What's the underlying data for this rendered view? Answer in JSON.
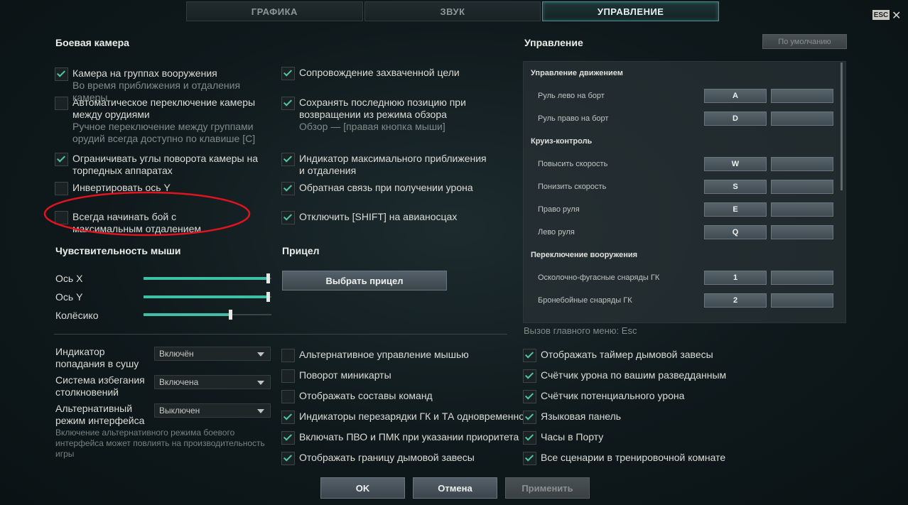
{
  "tabs": [
    {
      "label": "ГРАФИКА",
      "active": false
    },
    {
      "label": "ЗВУК",
      "active": false
    },
    {
      "label": "УПРАВЛЕНИЕ",
      "active": true
    }
  ],
  "esc_label": "ESC",
  "close_glyph": "✕",
  "combat_camera": {
    "title": "Боевая камера",
    "left": [
      {
        "label": "Камера на группах вооружения",
        "sub": "Во время приближения и отдаления камеры",
        "checked": true
      },
      {
        "label": "Автоматическое переключение камеры между орудиями",
        "sub": "Ручное переключение между группами орудий всегда доступно по клавише [C]",
        "checked": false
      },
      {
        "label": "Ограничивать углы поворота камеры на торпедных аппаратах",
        "sub": "",
        "checked": true
      },
      {
        "label": "Инвертировать ось Y",
        "sub": "",
        "checked": false
      },
      {
        "label": "Всегда начинать бой с максимальным отдалением",
        "sub": "",
        "checked": false
      }
    ],
    "right": [
      {
        "label": "Сопровождение захваченной цели",
        "sub": "",
        "checked": true
      },
      {
        "label": "Сохранять последнюю позицию при возвращении из режима обзора",
        "sub": "Обзор — [правая кнопка мыши]",
        "checked": true
      },
      {
        "label": "Индикатор максимального приближения и отдаления",
        "sub": "",
        "checked": true
      },
      {
        "label": "Обратная связь при получении урона",
        "sub": "",
        "checked": true
      },
      {
        "label": "Отключить [SHIFT] на авианосцах",
        "sub": "",
        "checked": true
      }
    ]
  },
  "mouse": {
    "title": "Чувствительность мыши",
    "sliders": [
      {
        "label": "Ось X",
        "value": 0.97
      },
      {
        "label": "Ось Y",
        "value": 0.97
      },
      {
        "label": "Колёсико",
        "value": 0.68
      }
    ]
  },
  "sight": {
    "title": "Прицел",
    "button": "Выбрать прицел"
  },
  "controls": {
    "title": "Управление",
    "default_button": "По умолчанию",
    "groups": [
      {
        "title": "Управление движением",
        "actions": [
          {
            "label": "Руль лево на борт",
            "key": "A"
          },
          {
            "label": "Руль право на борт",
            "key": "D"
          }
        ]
      },
      {
        "title": "Круиз-контроль",
        "actions": [
          {
            "label": "Повысить скорость",
            "key": "W"
          },
          {
            "label": "Понизить скорость",
            "key": "S"
          },
          {
            "label": "Право руля",
            "key": "E"
          },
          {
            "label": "Лево руля",
            "key": "Q"
          }
        ]
      },
      {
        "title": "Переключение вооружения",
        "actions": [
          {
            "label": "Осколочно-фугасные снаряды ГК",
            "key": "1"
          },
          {
            "label": "Бронебойные снаряды ГК",
            "key": "2"
          }
        ]
      }
    ],
    "menu_hint": "Вызов главного меню: Esc"
  },
  "dropdowns": [
    {
      "label": "Индикатор попадания в сушу",
      "value": "Включён"
    },
    {
      "label": "Система избегания столкновений",
      "value": "Включена"
    },
    {
      "label": "Альтернативный режим интерфейса",
      "value": "Выключен"
    }
  ],
  "interface_note": "Включение альтернативного режима боевого интерфейса может повлиять на производительность игры",
  "bottom_mid": [
    {
      "label": "Альтернативное управление мышью",
      "checked": false
    },
    {
      "label": "Поворот миникарты",
      "checked": false
    },
    {
      "label": "Отображать составы команд",
      "checked": false
    },
    {
      "label": "Индикаторы перезарядки ГК и ТА одновременно",
      "checked": true
    },
    {
      "label": "Включать ПВО и ПМК при указании приоритета",
      "checked": true
    },
    {
      "label": "Отображать границу дымовой завесы",
      "checked": true
    }
  ],
  "bottom_right": [
    {
      "label": "Отображать таймер дымовой завесы",
      "checked": true
    },
    {
      "label": "Счётчик урона по вашим разведданным",
      "checked": true
    },
    {
      "label": "Счётчик потенциального урона",
      "checked": true
    },
    {
      "label": "Языковая панель",
      "checked": true
    },
    {
      "label": "Часы в Порту",
      "checked": true
    },
    {
      "label": "Все сценарии в тренировочной комнате",
      "checked": true
    }
  ],
  "footer": {
    "ok": "OK",
    "cancel": "Отмена",
    "apply": "Применить"
  },
  "colors": {
    "accent": "#3fbfa5",
    "highlight_ellipse": "#e0141e"
  }
}
